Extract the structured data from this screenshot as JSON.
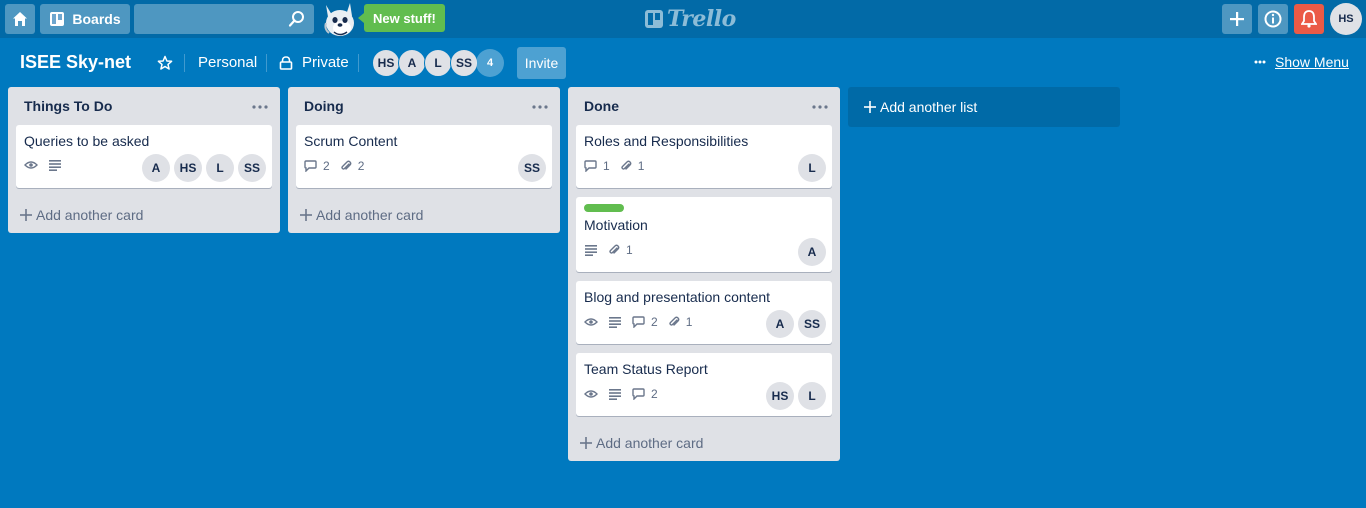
{
  "header": {
    "boards_label": "Boards",
    "search_placeholder": "",
    "new_stuff_label": "New stuff!",
    "logo_text": "Trello",
    "user_initials": "HS"
  },
  "board": {
    "title": "ISEE Sky-net",
    "team": "Personal",
    "visibility": "Private",
    "members": [
      "HS",
      "A",
      "L",
      "SS"
    ],
    "member_count": "4",
    "invite_label": "Invite",
    "show_menu_label": "Show Menu",
    "add_list_label": "Add another list"
  },
  "lists": [
    {
      "title": "Things To Do",
      "add_card_label": "Add another card",
      "cards": [
        {
          "title": "Queries to be asked",
          "watch": true,
          "description": true,
          "members": [
            "A",
            "HS",
            "L",
            "SS"
          ]
        }
      ]
    },
    {
      "title": "Doing",
      "add_card_label": "Add another card",
      "cards": [
        {
          "title": "Scrum Content",
          "comments": "2",
          "attachments": "2",
          "members": [
            "SS"
          ]
        }
      ]
    },
    {
      "title": "Done",
      "add_card_label": "Add another card",
      "cards": [
        {
          "title": "Roles and Responsibilities",
          "comments": "1",
          "attachments": "1",
          "members": [
            "L"
          ]
        },
        {
          "title": "Motivation",
          "label_color": "#61bd4f",
          "description": true,
          "attachments": "1",
          "members": [
            "A"
          ]
        },
        {
          "title": "Blog and presentation content",
          "watch": true,
          "description": true,
          "comments": "2",
          "attachments": "1",
          "members": [
            "A",
            "SS"
          ]
        },
        {
          "title": "Team Status Report",
          "watch": true,
          "description": true,
          "comments": "2",
          "members": [
            "HS",
            "L"
          ]
        }
      ]
    }
  ],
  "colors": {
    "board_bg": "#0079bf",
    "header_bg": "#026aa7",
    "list_bg": "#dfe1e6",
    "notification_red": "#eb5a46",
    "new_stuff_green": "#61bd4f"
  }
}
